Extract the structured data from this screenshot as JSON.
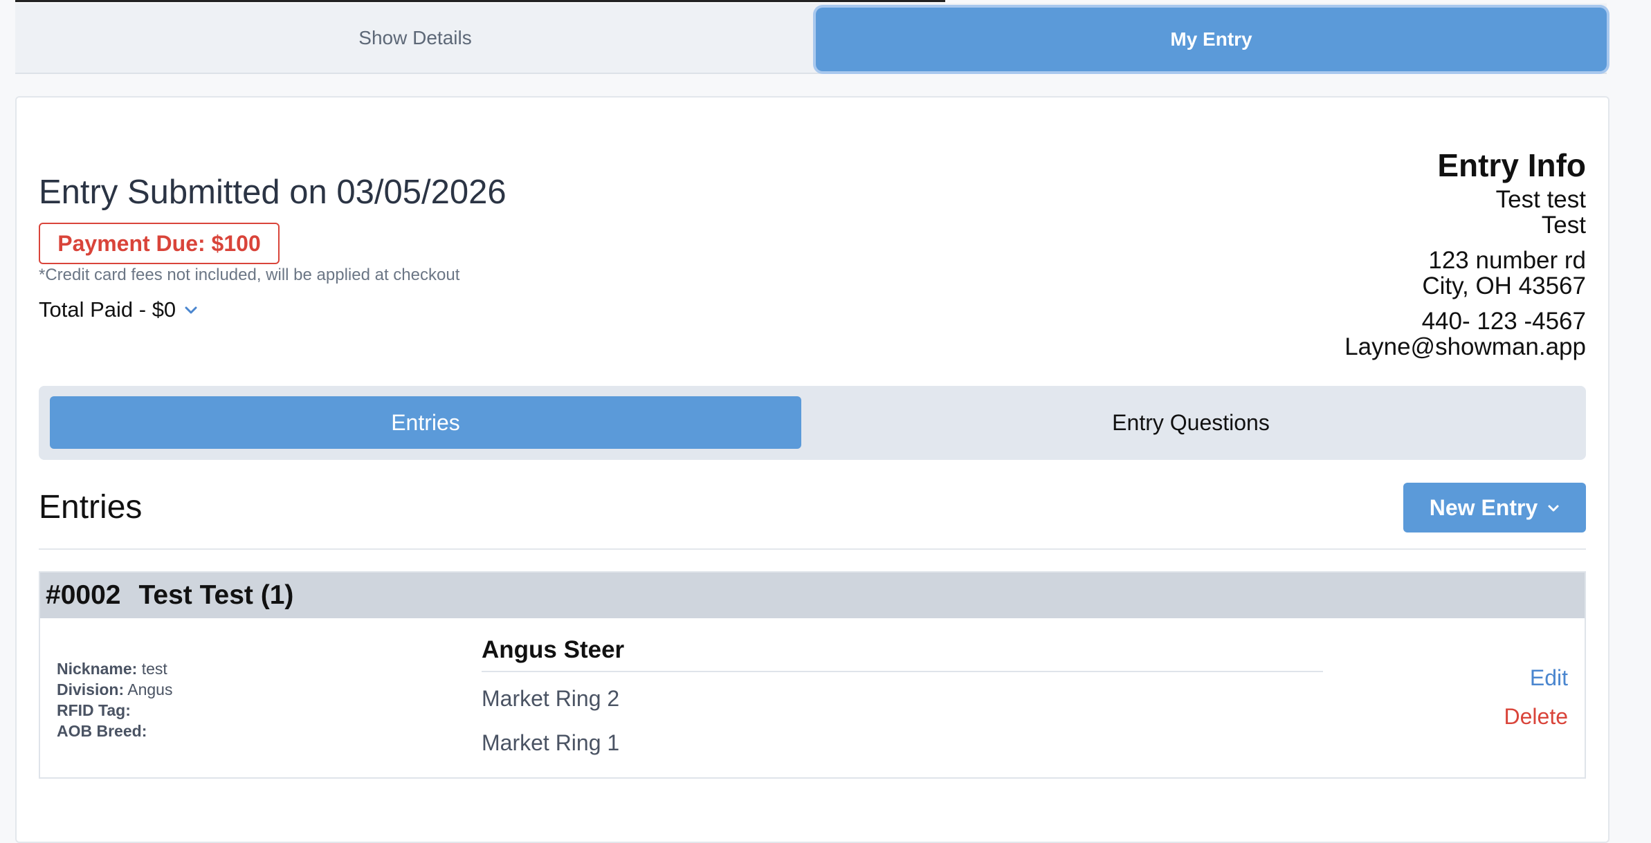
{
  "top_tabs": {
    "show_details": "Show Details",
    "my_entry": "My Entry"
  },
  "summary": {
    "submitted": "Entry Submitted on 03/05/2026",
    "payment_due": "Payment Due: $100",
    "fee_note": "*Credit card fees not included, will be applied at checkout",
    "total_paid": "Total Paid - $0"
  },
  "entry_info": {
    "heading": "Entry Info",
    "name": "Test test",
    "organization": "Test",
    "address_line1": "123 number rd",
    "address_line2": "City, OH 43567",
    "phone": "440- 123 -4567",
    "email": "Layne@showman.app"
  },
  "sub_tabs": {
    "entries": "Entries",
    "entry_questions": "Entry Questions"
  },
  "entries_section": {
    "title": "Entries",
    "new_entry_label": "New Entry"
  },
  "entry": {
    "number": "#0002",
    "name": "Test Test (1)",
    "nickname_label": "Nickname:",
    "nickname": "test",
    "division_label": "Division:",
    "division": "Angus",
    "rfid_label": "RFID Tag:",
    "rfid": "",
    "aob_label": "AOB Breed:",
    "aob": "",
    "class_title": "Angus Steer",
    "rings": [
      "Market Ring 2",
      "Market Ring 1"
    ],
    "edit_label": "Edit",
    "delete_label": "Delete"
  },
  "colors": {
    "accent": "#5b9ad9",
    "danger": "#d9443a",
    "link": "#4a86cf"
  },
  "icons": {
    "total_paid_toggle": "chevron-down-icon",
    "new_entry_toggle": "chevron-down-icon"
  }
}
